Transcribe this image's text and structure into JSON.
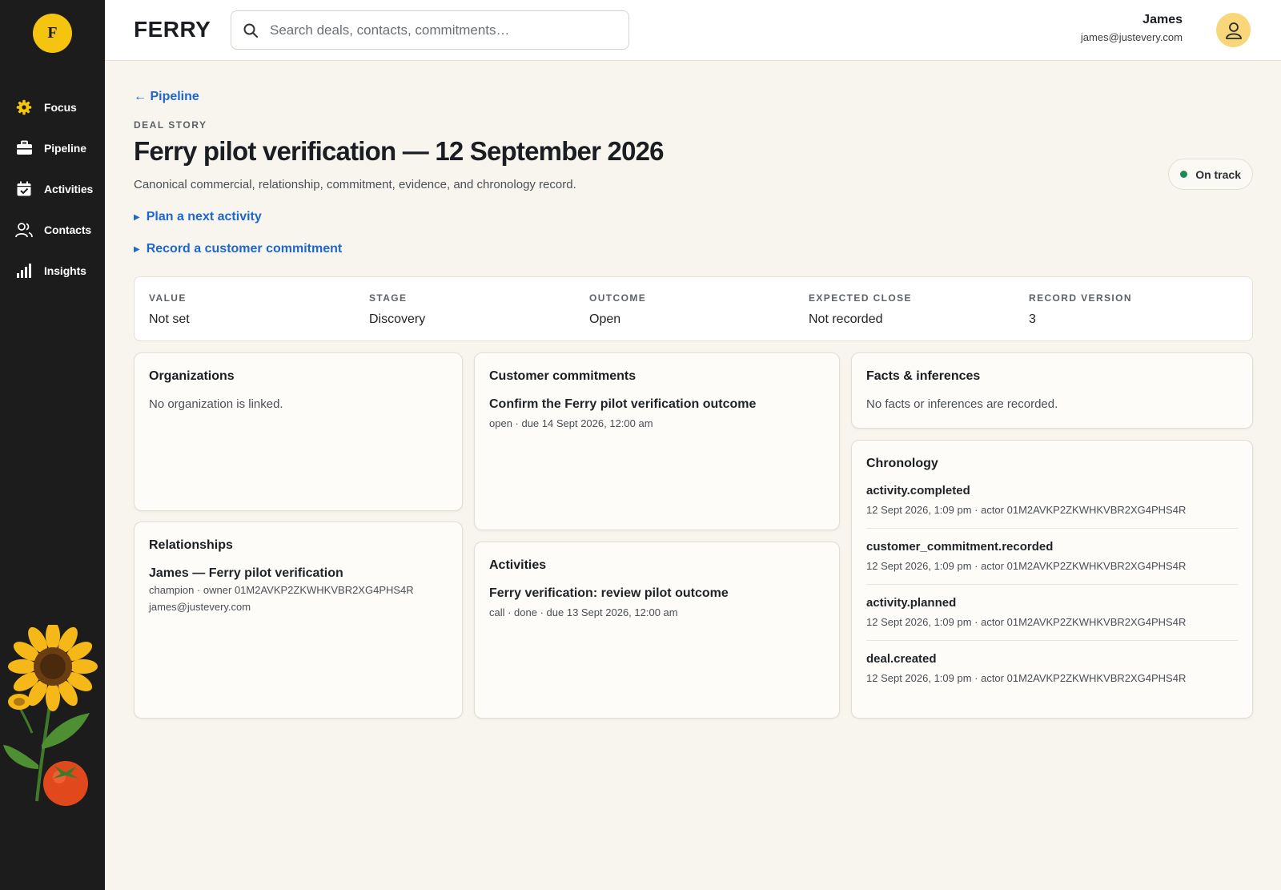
{
  "sidebar": {
    "logo_letter": "F",
    "items": [
      {
        "label": "Focus",
        "icon": "gear-icon"
      },
      {
        "label": "Pipeline",
        "icon": "briefcase-icon"
      },
      {
        "label": "Activities",
        "icon": "calendar-check-icon"
      },
      {
        "label": "Contacts",
        "icon": "users-icon"
      },
      {
        "label": "Insights",
        "icon": "bar-chart-icon"
      }
    ]
  },
  "topbar": {
    "brand": "FERRY",
    "search_placeholder": "Search deals, contacts, commitments…",
    "user_name": "James",
    "user_email": "james@justevery.com"
  },
  "page": {
    "back_label": "← Pipeline",
    "eyebrow": "DEAL STORY",
    "title": "Ferry pilot verification — 12 September 2026",
    "subtitle": "Canonical commercial, relationship, commitment, evidence, and chronology record.",
    "status": "On track",
    "status_color": "#1f8a55",
    "plan_activity": "Plan a next activity",
    "record_commitment": "Record a customer commitment"
  },
  "summary": [
    {
      "label": "VALUE",
      "value": "Not set"
    },
    {
      "label": "STAGE",
      "value": "Discovery"
    },
    {
      "label": "OUTCOME",
      "value": "Open"
    },
    {
      "label": "EXPECTED CLOSE",
      "value": "Not recorded"
    },
    {
      "label": "RECORD VERSION",
      "value": "3"
    }
  ],
  "organizations": {
    "title": "Organizations",
    "empty": "No organization is linked."
  },
  "relationships": {
    "title": "Relationships",
    "item_title": "James — Ferry pilot verification",
    "item_meta": "champion · owner 01M2AVKP2ZKWHKVBR2XG4PHS4R",
    "item_email": "james@justevery.com"
  },
  "commitments": {
    "title": "Customer commitments",
    "item_title": "Confirm the Ferry pilot verification outcome",
    "item_meta": "open · due 14 Sept 2026, 12:00 am"
  },
  "activities": {
    "title": "Activities",
    "item_title": "Ferry verification: review pilot outcome",
    "item_meta": "call · done · due 13 Sept 2026, 12:00 am"
  },
  "facts": {
    "title": "Facts & inferences",
    "empty": "No facts or inferences are recorded."
  },
  "chronology": {
    "title": "Chronology",
    "items": [
      {
        "event": "activity.completed",
        "meta": "12 Sept 2026, 1:09 pm · actor 01M2AVKP2ZKWHKVBR2XG4PHS4R"
      },
      {
        "event": "customer_commitment.recorded",
        "meta": "12 Sept 2026, 1:09 pm · actor 01M2AVKP2ZKWHKVBR2XG4PHS4R"
      },
      {
        "event": "activity.planned",
        "meta": "12 Sept 2026, 1:09 pm · actor 01M2AVKP2ZKWHKVBR2XG4PHS4R"
      },
      {
        "event": "deal.created",
        "meta": "12 Sept 2026, 1:09 pm · actor 01M2AVKP2ZKWHKVBR2XG4PHS4R"
      }
    ]
  },
  "colors": {
    "sidebar_bg": "#1c1c1c",
    "accent_yellow": "#f5c40f",
    "link_blue": "#1e66d0",
    "page_bg": "#f8f5ee"
  }
}
